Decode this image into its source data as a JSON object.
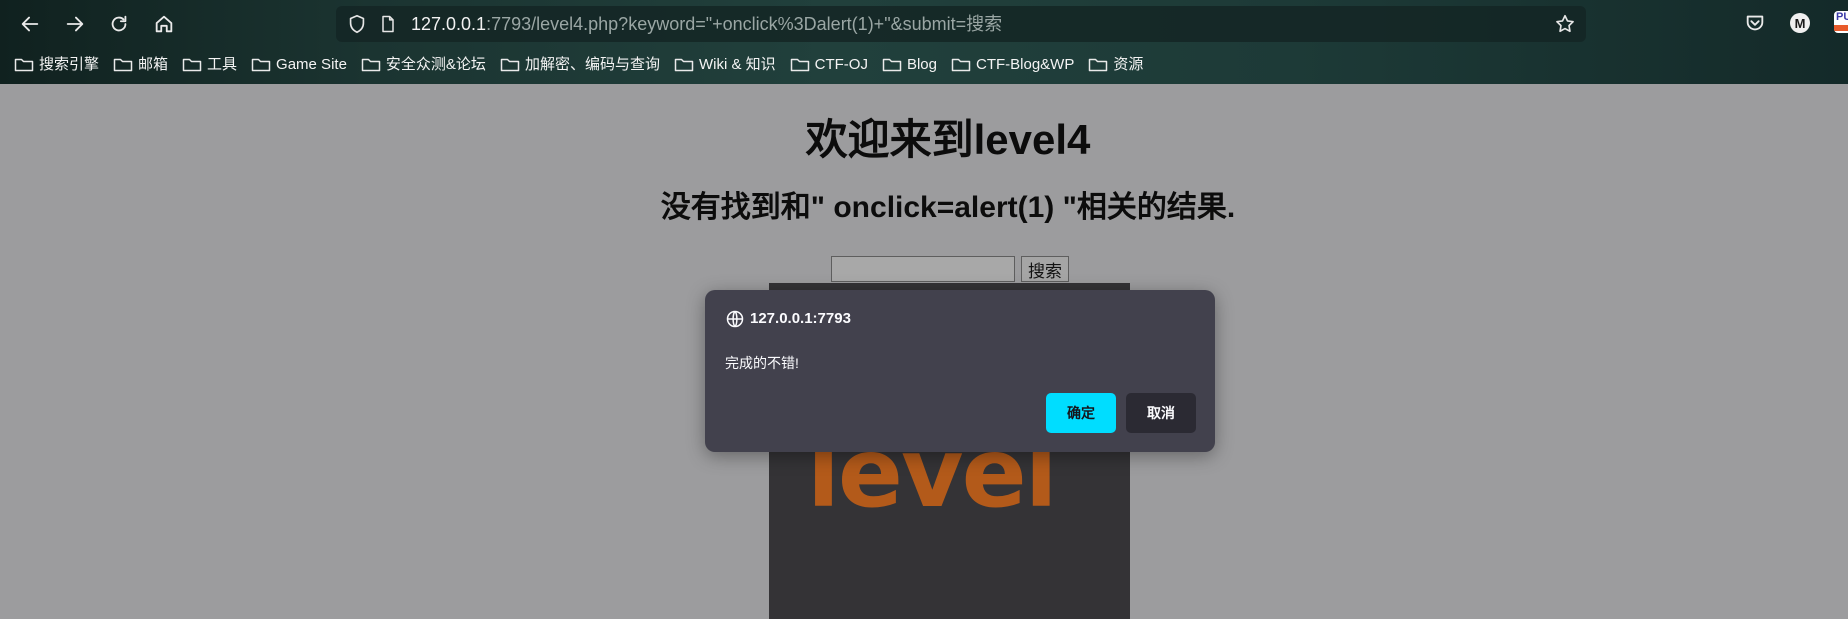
{
  "browser": {
    "url": {
      "host": "127.0.0.1",
      "rest": ":7793/level4.php?keyword=\"+onclick%3Dalert(1)+\"&submit=搜索"
    },
    "profile_initial": "M",
    "extension_label": "PU",
    "bookmarks": [
      {
        "label": "搜索引擎"
      },
      {
        "label": "邮箱"
      },
      {
        "label": "工具"
      },
      {
        "label": "Game Site"
      },
      {
        "label": "安全众测&论坛"
      },
      {
        "label": "加解密、编码与查询"
      },
      {
        "label": "Wiki & 知识"
      },
      {
        "label": "CTF-OJ"
      },
      {
        "label": "Blog"
      },
      {
        "label": "CTF-Blog&WP"
      },
      {
        "label": "资源"
      }
    ]
  },
  "page": {
    "title": "欢迎来到level4",
    "result_text": "没有找到和\" onclick=alert(1) \"相关的结果.",
    "search_value": "",
    "search_button": "搜索",
    "image_word": "level"
  },
  "dialog": {
    "origin": "127.0.0.1:7793",
    "message": "完成的不错!",
    "ok_label": "确定",
    "cancel_label": "取消"
  },
  "colors": {
    "accent": "#00ddff",
    "dialog_bg": "#42414d",
    "page_overlay": "#9c9c9e",
    "image_word": "#b35a1a"
  }
}
